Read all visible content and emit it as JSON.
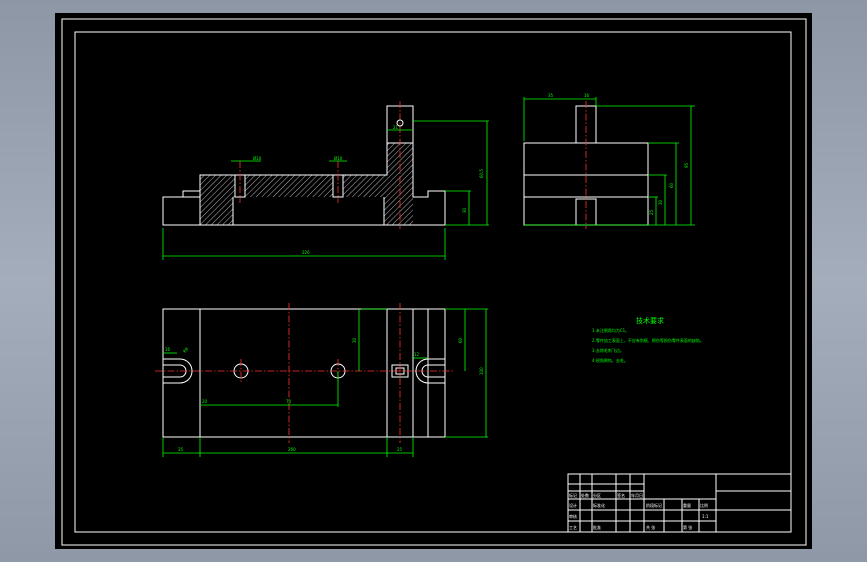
{
  "colors": {
    "background": "#000000",
    "outline": "#ffffff",
    "dimension": "#00ff00",
    "centerline": "#ff3030"
  },
  "dims": {
    "top_len": "226",
    "top_h1": "60.5",
    "top_h2": "30",
    "top_w1": "21",
    "top_ra1": "Ø10",
    "top_ra2": "Ø10",
    "side_a": "35",
    "side_b": "16",
    "side_c": "95",
    "side_d": "60",
    "side_e": "30",
    "side_f": "25",
    "plan_a": "16",
    "plan_b": "R8",
    "plan_c": "30",
    "plan_d": "20",
    "plan_e": "70",
    "plan_f": "60",
    "plan_g": "100",
    "plan_h": "12",
    "plan_i": "5",
    "plan_bot1": "35",
    "plan_bot2": "260",
    "plan_bot3": "25"
  },
  "tech": {
    "title": "技术要求",
    "lines": [
      "1.未注倒角均为C1。",
      "2.零件加工表面上，不应有划痕、擦伤等损伤零件表面的缺陷。",
      "3.去除毛刺飞边。",
      "4.锐角倒钝，去毛。"
    ]
  },
  "title_block": {
    "r1": [
      "标记",
      "处数",
      "分区",
      "更改文件号",
      "签名",
      "年月日"
    ],
    "r2": [
      "设计",
      "",
      "标准化",
      "",
      "阶段标记",
      "重量",
      "比例"
    ],
    "r3": [
      "审核",
      "",
      "",
      "",
      "",
      "",
      "1:1"
    ],
    "r4": [
      "工艺",
      "",
      "批准",
      "",
      "共 张",
      "第 张"
    ]
  }
}
